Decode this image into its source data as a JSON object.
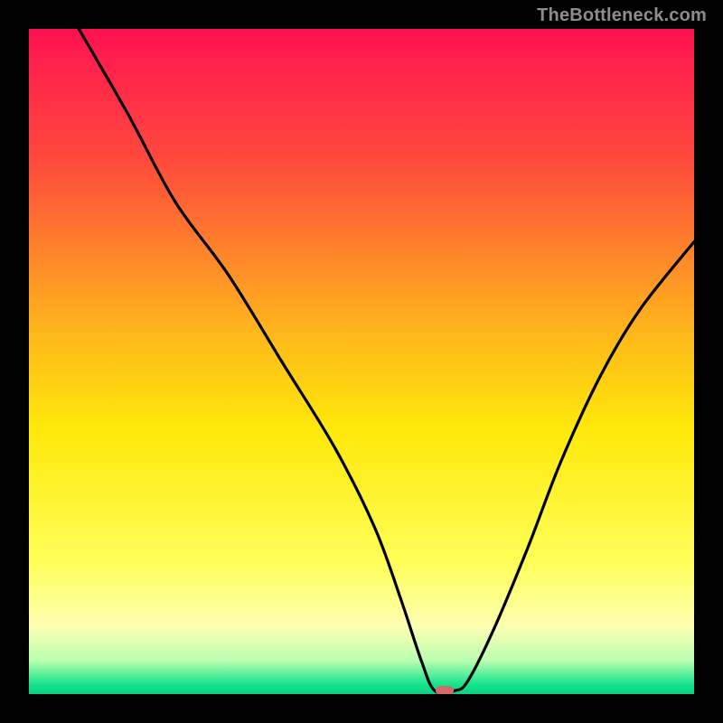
{
  "watermark": {
    "text": "TheBottleneck.com",
    "color": "#8d8d8d"
  },
  "chart_data": {
    "type": "line",
    "title": "",
    "xlabel": "",
    "ylabel": "",
    "xlim": [
      0,
      100
    ],
    "ylim": [
      0,
      100
    ],
    "grid": false,
    "legend": false,
    "background_gradient_stops": [
      {
        "pos": 0.0,
        "color": "#ff1152"
      },
      {
        "pos": 0.2,
        "color": "#ff4b3c"
      },
      {
        "pos": 0.45,
        "color": "#ffb41c"
      },
      {
        "pos": 0.6,
        "color": "#ffe80a"
      },
      {
        "pos": 0.8,
        "color": "#ffff57"
      },
      {
        "pos": 0.9,
        "color": "#fdffb3"
      },
      {
        "pos": 0.95,
        "color": "#b9ffb0"
      },
      {
        "pos": 0.985,
        "color": "#16e58c"
      },
      {
        "pos": 1.0,
        "color": "#0bd184"
      }
    ],
    "series": [
      {
        "name": "bottleneck-curve",
        "color": "#000000",
        "x": [
          7.5,
          15,
          22,
          30,
          38,
          46,
          52,
          56,
          59,
          61,
          64,
          66,
          70,
          75,
          80,
          86,
          92,
          100
        ],
        "y": [
          100,
          87,
          74,
          63,
          50,
          37,
          25,
          14,
          5,
          0.5,
          0.5,
          2,
          10,
          22,
          35,
          48,
          58,
          68
        ]
      }
    ],
    "marker": {
      "name": "optimal-point",
      "x": 62.5,
      "y": 0.5,
      "width_pct": 2.8,
      "height_pct": 1.4,
      "color": "#d56a6d"
    }
  }
}
